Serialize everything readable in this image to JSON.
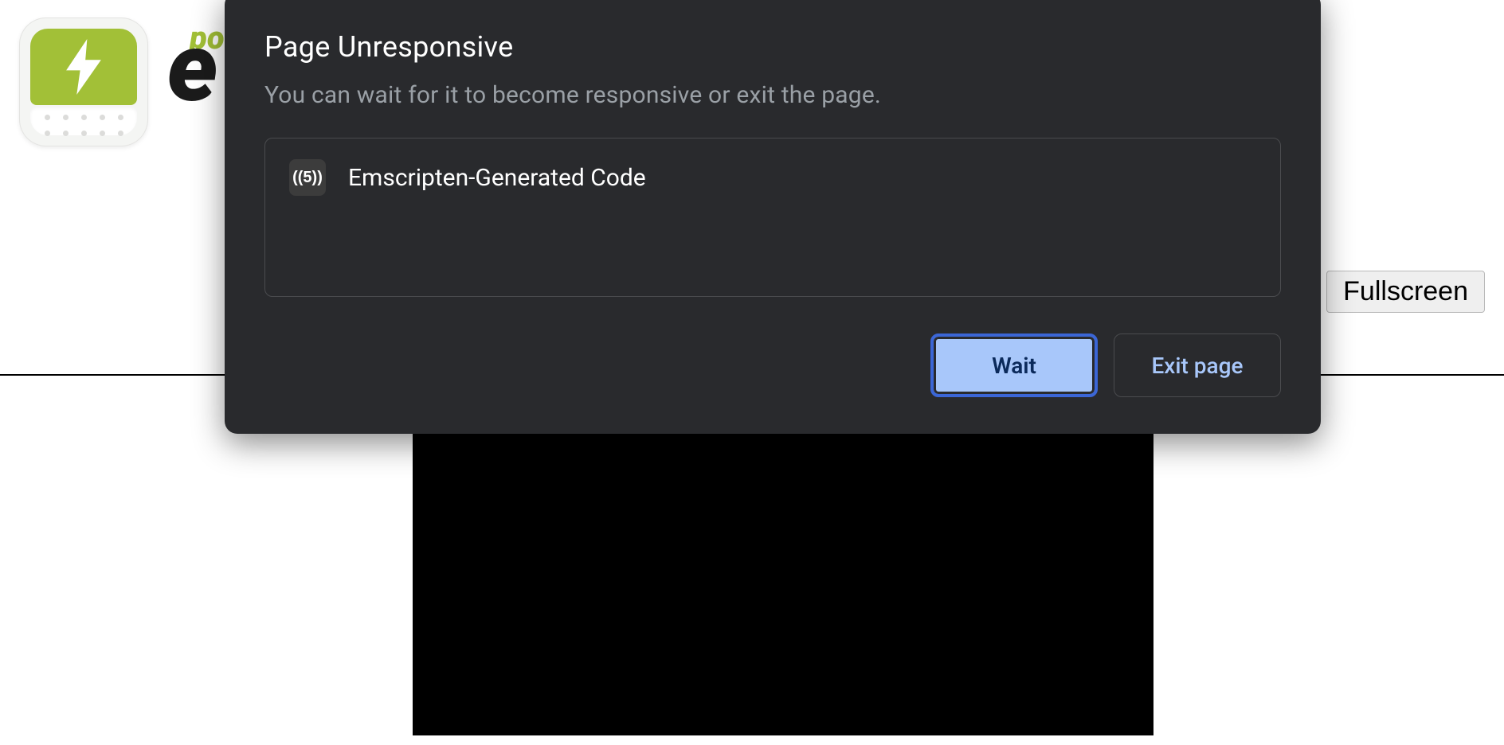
{
  "page": {
    "wordmark_fragment": "e",
    "powered_fragment": "po",
    "fullscreen_label": "Fullscreen"
  },
  "dialog": {
    "title": "Page Unresponsive",
    "subtitle": "You can wait for it to become responsive or exit the page.",
    "process_name": "Emscripten-Generated Code",
    "favicon_label": "((5))",
    "actions": {
      "wait": "Wait",
      "exit": "Exit page"
    }
  }
}
